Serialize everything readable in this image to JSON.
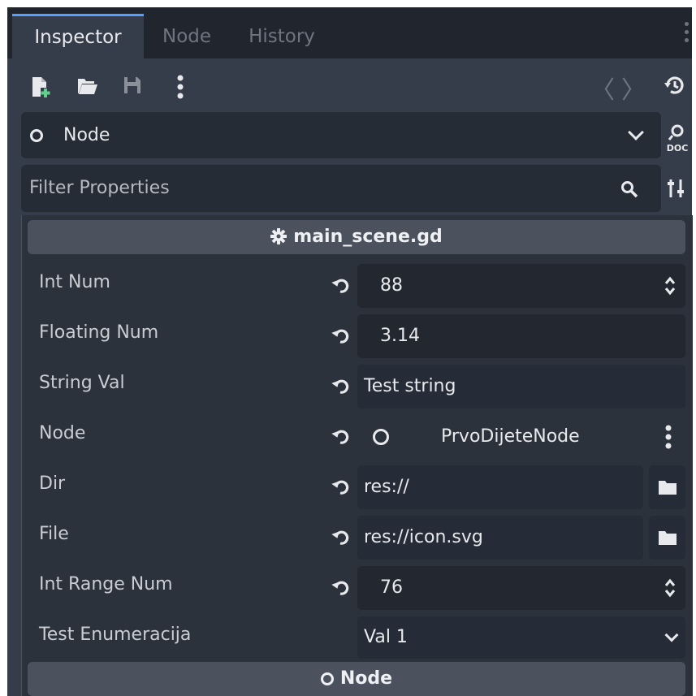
{
  "tabs": [
    {
      "label": "Inspector",
      "active": true
    },
    {
      "label": "Node",
      "active": false
    },
    {
      "label": "History",
      "active": false
    }
  ],
  "toolbar": {
    "icons": [
      "new-resource-icon",
      "open-folder-icon",
      "save-icon",
      "more-vertical-icon"
    ],
    "back_arrow": "〈",
    "forward_arrow": "〉",
    "history_icon": "history-icon"
  },
  "node_select": {
    "label": "Node"
  },
  "doc_button": {
    "label": "DOC"
  },
  "filter": {
    "placeholder": "Filter Properties"
  },
  "script_section": {
    "title": "main_scene.gd",
    "icon": "gear-icon"
  },
  "properties": [
    {
      "label": "Int Num",
      "value": "88",
      "type": "spin"
    },
    {
      "label": "Floating Num",
      "value": "3.14",
      "type": "spin-plain"
    },
    {
      "label": "String Val",
      "value": "Test string",
      "type": "text"
    },
    {
      "label": "Node",
      "value": "PrvoDijeteNode",
      "type": "node"
    },
    {
      "label": "Dir",
      "value": "res://",
      "type": "path"
    },
    {
      "label": "File",
      "value": "res://icon.svg",
      "type": "path"
    },
    {
      "label": "Int Range Num",
      "value": "76",
      "type": "spin"
    },
    {
      "label": "Test Enumeracija",
      "value": "Val 1",
      "type": "enum"
    }
  ],
  "node_section": {
    "title": "Node"
  },
  "colors": {
    "accent": "#569eff",
    "panel_bg": "#363d4a",
    "tabbar_bg": "#21262e",
    "field_bg": "#232830",
    "section_bg": "#4b525e"
  }
}
